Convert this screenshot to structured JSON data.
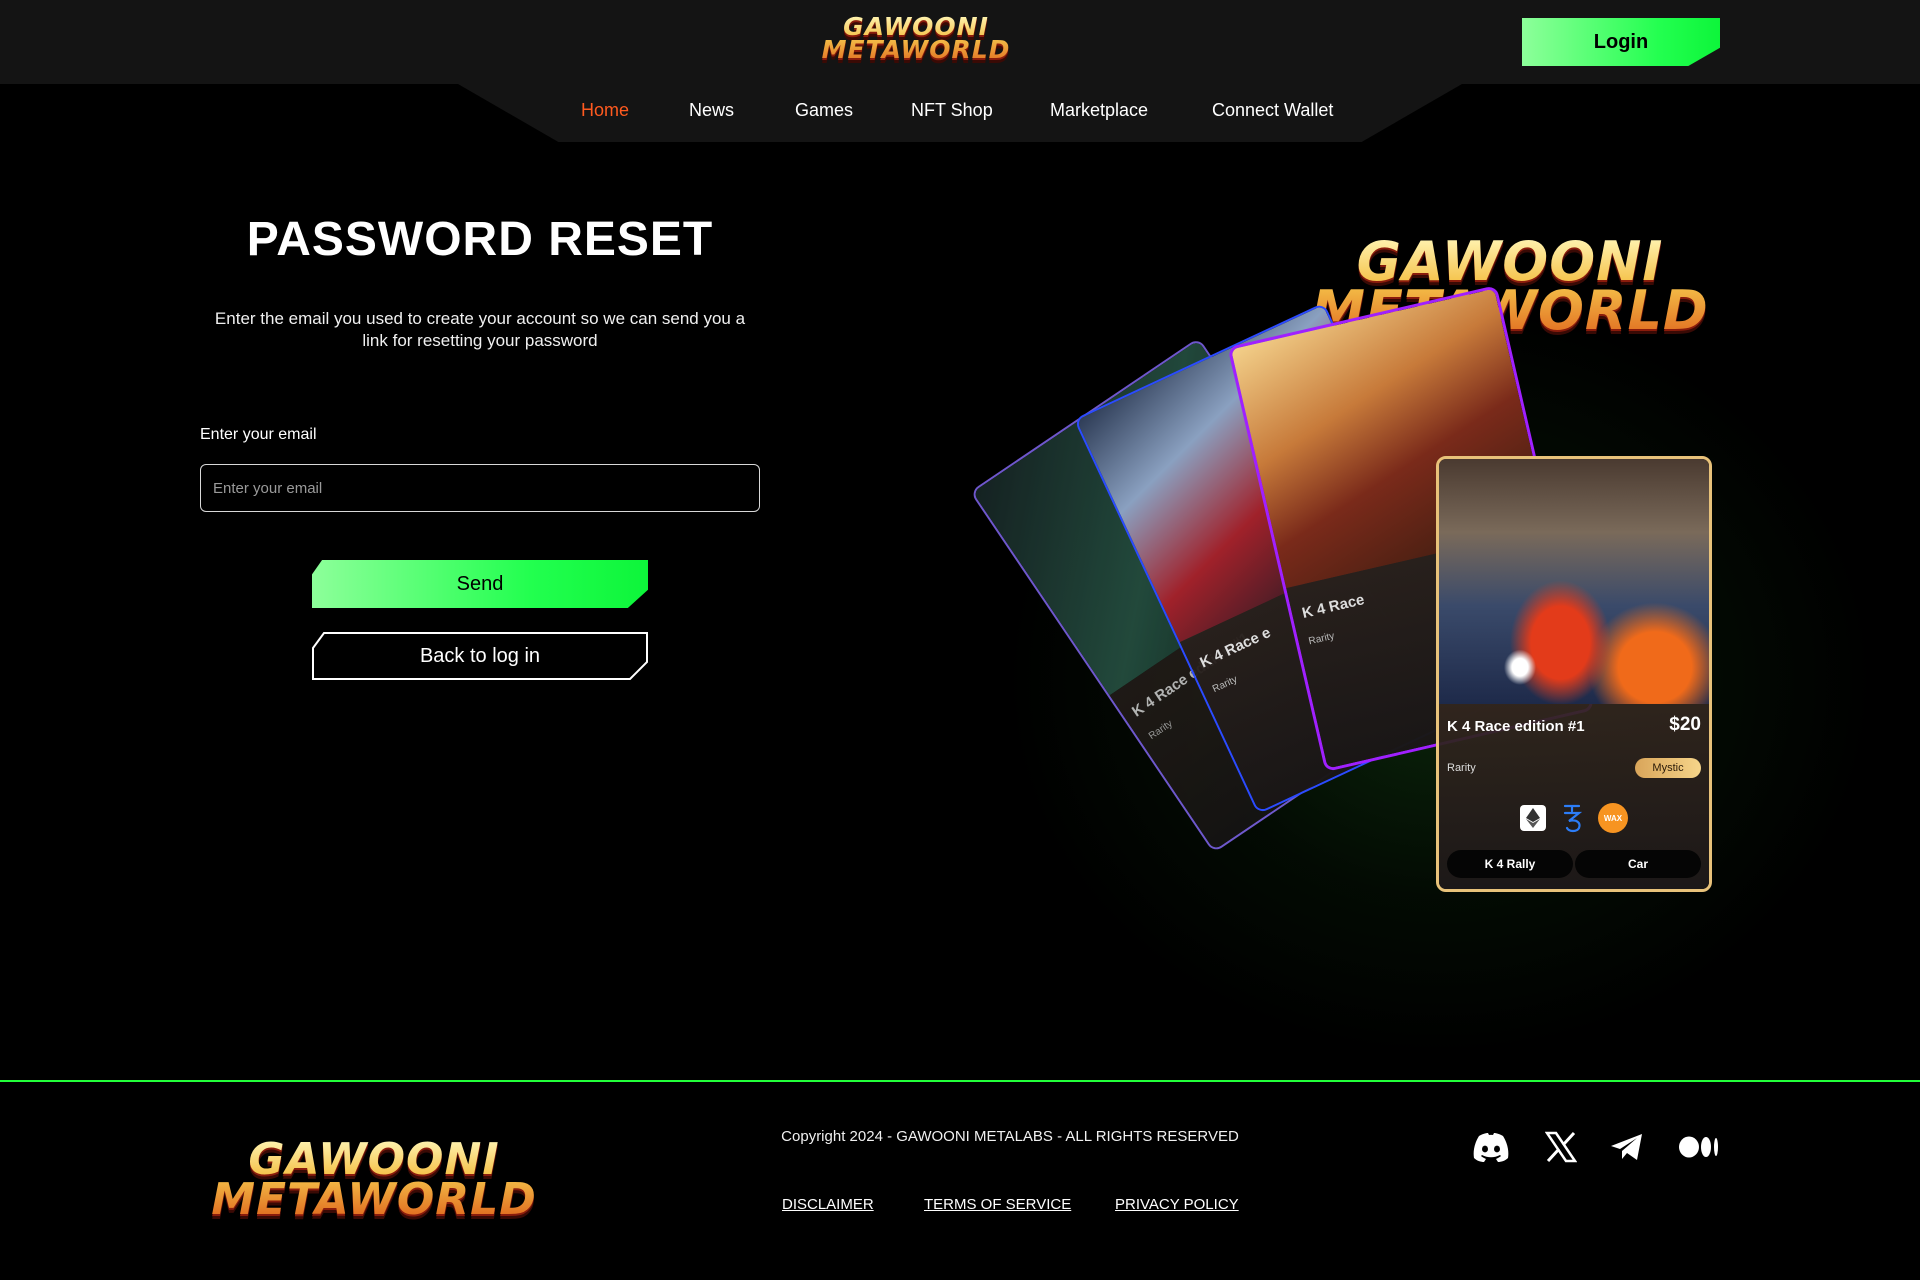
{
  "header": {
    "logo_line1": "GAWOONI",
    "logo_line2": "METAWORLD",
    "login_label": "Login"
  },
  "nav": {
    "items": [
      {
        "label": "Home",
        "active": true
      },
      {
        "label": "News"
      },
      {
        "label": "Games"
      },
      {
        "label": "NFT Shop"
      },
      {
        "label": "Marketplace"
      },
      {
        "label": "Connect Wallet"
      }
    ]
  },
  "reset": {
    "title": "PASSWORD RESET",
    "subtitle": "Enter the email you used to create your account so we can send you a link for resetting your password",
    "email_label": "Enter your email",
    "email_placeholder": "Enter your email",
    "email_value": "",
    "send_label": "Send",
    "back_label": "Back to log in"
  },
  "hero": {
    "logo_line1": "GAWOONI",
    "logo_line2": "METAWORLD",
    "back_cards": [
      {
        "title": "K 4 Race edition #1",
        "rarity": "Rarity"
      },
      {
        "title": "K 4 Race e",
        "rarity": "Rarity"
      },
      {
        "title": "K 4 Race",
        "rarity": "Rarity"
      }
    ],
    "nft_card": {
      "title": "K 4 Race edition #1",
      "price": "$20",
      "rarity_label": "Rarity",
      "rarity_value": "Mystic",
      "chains": [
        "ethereum-icon",
        "tezos-icon",
        "wax-icon"
      ],
      "wax_text": "WAX",
      "tags": [
        "K 4 Rally",
        "Car"
      ]
    }
  },
  "footer": {
    "logo_line1": "GAWOONI",
    "logo_line2": "METAWORLD",
    "copyright": "Copyright 2024 - GAWOONI METALABS - ALL RIGHTS RESERVED",
    "links": [
      "DISCLAIMER",
      "TERMS OF SERVICE",
      "PRIVACY POLICY"
    ],
    "socials": [
      "discord-icon",
      "x-icon",
      "telegram-icon",
      "medium-icon"
    ]
  },
  "colors": {
    "accent_green": "#22ff4f",
    "active_nav": "#ff5a1f",
    "card_border_gold": "#e8c27a",
    "footer_line": "#22ff3a"
  }
}
